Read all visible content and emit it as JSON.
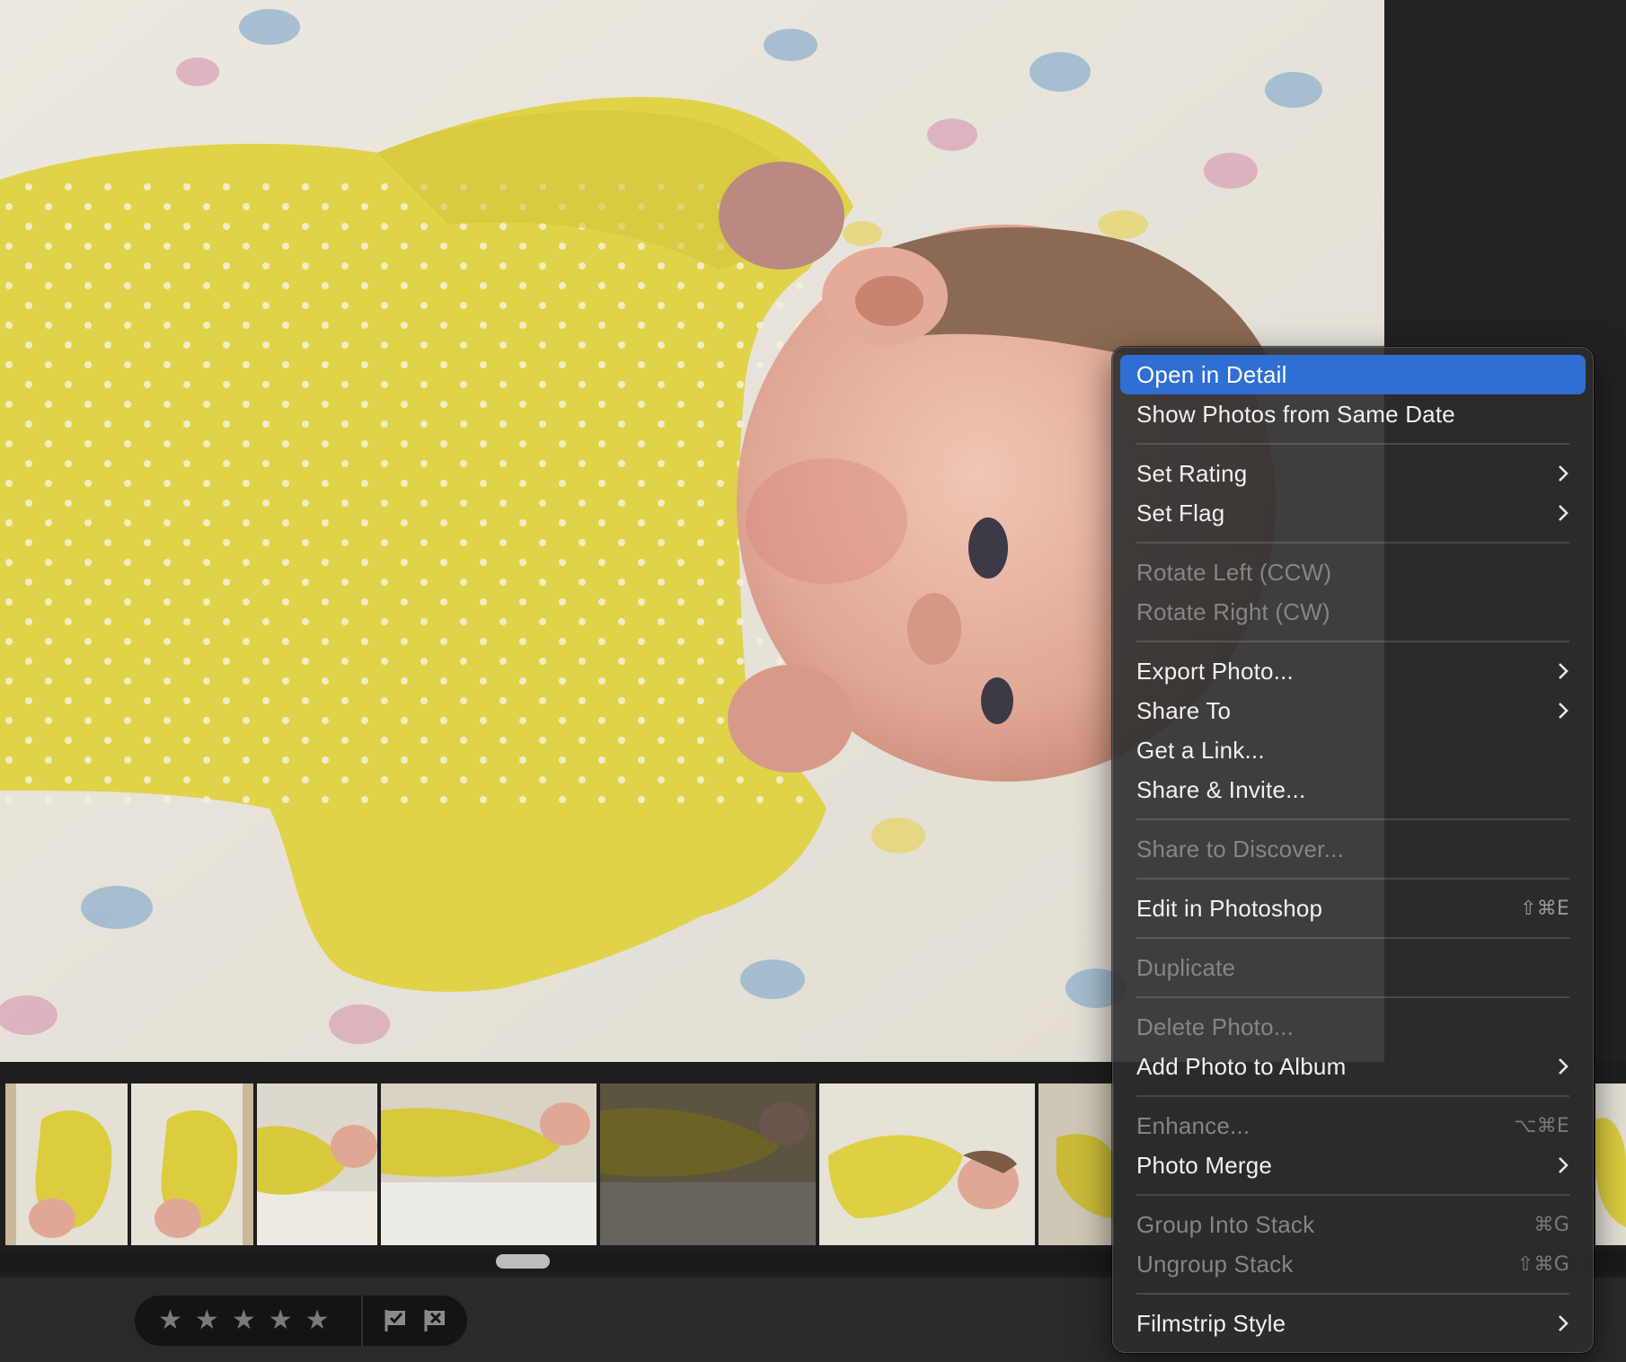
{
  "context_menu": {
    "items": [
      {
        "label": "Open in Detail",
        "state": "highlighted"
      },
      {
        "label": "Show Photos from Same Date",
        "state": "enabled"
      },
      {
        "label": "Set Rating",
        "state": "enabled",
        "submenu": true
      },
      {
        "label": "Set Flag",
        "state": "enabled",
        "submenu": true
      },
      {
        "label": "Rotate Left (CCW)",
        "state": "disabled"
      },
      {
        "label": "Rotate Right (CW)",
        "state": "disabled"
      },
      {
        "label": "Export Photo...",
        "state": "enabled",
        "submenu": true
      },
      {
        "label": "Share To",
        "state": "enabled",
        "submenu": true
      },
      {
        "label": "Get a Link...",
        "state": "enabled"
      },
      {
        "label": "Share & Invite...",
        "state": "enabled"
      },
      {
        "label": "Share to Discover...",
        "state": "disabled"
      },
      {
        "label": "Edit in Photoshop",
        "state": "enabled",
        "shortcut": "⇧⌘E"
      },
      {
        "label": "Duplicate",
        "state": "disabled"
      },
      {
        "label": "Delete Photo...",
        "state": "disabled"
      },
      {
        "label": "Add Photo to Album",
        "state": "enabled",
        "submenu": true
      },
      {
        "label": "Enhance...",
        "state": "disabled",
        "shortcut": "⌥⌘E"
      },
      {
        "label": "Photo Merge",
        "state": "enabled",
        "submenu": true
      },
      {
        "label": "Group Into Stack",
        "state": "disabled",
        "shortcut": "⌘G"
      },
      {
        "label": "Ungroup Stack",
        "state": "disabled",
        "shortcut": "⇧⌘G"
      },
      {
        "label": "Filmstrip Style",
        "state": "enabled",
        "submenu": true
      }
    ]
  },
  "rating_bar": {
    "stars": [
      "★",
      "★",
      "★",
      "★",
      "★"
    ],
    "rating": 0,
    "flags": [
      "flag-pick-icon",
      "flag-reject-icon"
    ]
  },
  "colors": {
    "highlight": "#2f6fd3",
    "menu_bg": "#2c2c2e",
    "onesie": "#e0d64a",
    "background": "#1b1b1b"
  }
}
